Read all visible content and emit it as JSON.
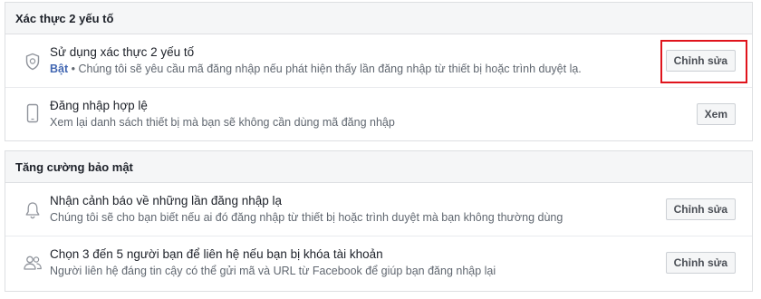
{
  "two_factor": {
    "title": "Xác thực 2 yếu tố",
    "use_2fa": {
      "title": "Sử dụng xác thực 2 yếu tố",
      "status": "Bật",
      "description": " • Chúng tôi sẽ yêu cầu mã đăng nhập nếu phát hiện thấy lần đăng nhập từ thiết bị hoặc trình duyệt lạ.",
      "button": "Chỉnh sửa",
      "icon": "shield-icon"
    },
    "authorized_logins": {
      "title": "Đăng nhập hợp lệ",
      "description": "Xem lại danh sách thiết bị mà bạn sẽ không cần dùng mã đăng nhập",
      "button": "Xem",
      "icon": "phone-icon"
    }
  },
  "extra_security": {
    "title": "Tăng cường bảo mật",
    "login_alerts": {
      "title": "Nhận cảnh báo về những lần đăng nhập lạ",
      "description": "Chúng tôi sẽ cho bạn biết nếu ai đó đăng nhập từ thiết bị hoặc trình duyệt mà bạn không thường dùng",
      "button": "Chỉnh sửa",
      "icon": "bell-icon"
    },
    "trusted_contacts": {
      "title": "Chọn 3 đến 5 người bạn để liên hệ nếu bạn bị khóa tài khoản",
      "description": "Người liên hệ đáng tin cậy có thể gửi mã và URL từ Facebook để giúp bạn đăng nhập lại",
      "button": "Chỉnh sửa",
      "icon": "people-icon"
    }
  },
  "colors": {
    "status_on": "#4267b2",
    "highlight": "#e0141c",
    "header_bg": "#f5f6f7"
  }
}
